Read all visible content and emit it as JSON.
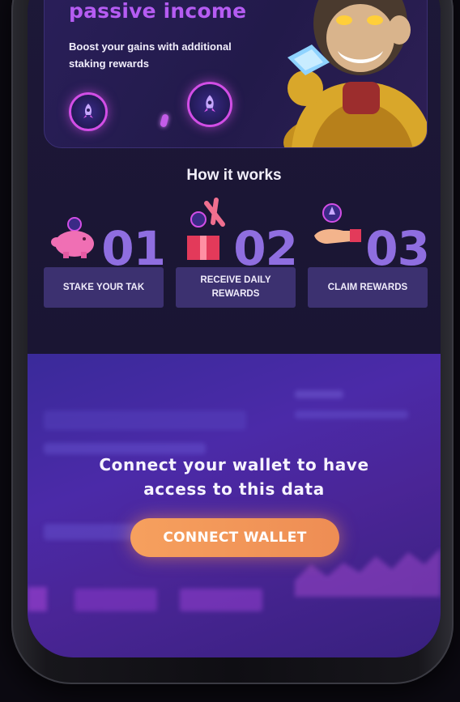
{
  "promo": {
    "title": "passive income",
    "description": "Boost your gains with additional staking rewards"
  },
  "how_it_works": {
    "title": "How it works",
    "steps": [
      {
        "number": "01",
        "label": "STAKE YOUR TAK",
        "icon": "piggy-bank-icon"
      },
      {
        "number": "02",
        "label": "RECEIVE DAILY REWARDS",
        "icon": "gift-box-icon"
      },
      {
        "number": "03",
        "label": "CLAIM REWARDS",
        "icon": "hand-icon"
      }
    ]
  },
  "connect": {
    "message_line1": "Connect your wallet to have",
    "message_line2": "access to this data",
    "button_label": "CONNECT WALLET"
  },
  "colors": {
    "accent_purple": "#b55cf2",
    "button_orange": "#f39a5b",
    "step_number": "#8f6ee0"
  }
}
